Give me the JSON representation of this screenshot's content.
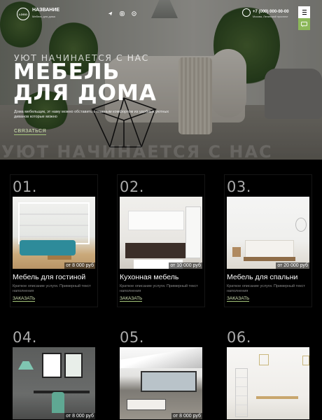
{
  "header": {
    "logo_text": "LOGO",
    "brand_name": "НАЗВАНИЕ",
    "brand_tagline": "Мебель для дома",
    "socials": [
      "telegram-icon",
      "instagram-icon",
      "whatsapp-icon"
    ],
    "phone": "+7 (000) 000-00-00",
    "address": "Москва, Ленинский проспект"
  },
  "hero": {
    "kicker": "УЮТ НАЧИНАЕТСЯ С НАС",
    "title_line1": "МЕБЕЛЬ",
    "title_line2": "ДЛЯ ДОМА",
    "description": "Дома мебельщик, эт наму можно обставить с главным комфортом из удобных уютных диванов которые можно",
    "cta": "СВЯЗАТЬСЯ",
    "ghost_text": "УЮТ НАЧИНАЕТСЯ С НАС"
  },
  "colors": {
    "accent": "#8cb85a",
    "background": "#000000"
  },
  "cards": [
    {
      "num": "01.",
      "title": "Мебель для гостиной",
      "desc": "Краткое описание услуги. Примерный текст наполнения",
      "price": "от 8 000 руб",
      "order": "ЗАКАЗАТЬ"
    },
    {
      "num": "02.",
      "title": "Кухонная мебель",
      "desc": "Краткое описание услуги. Примерный текст наполнения",
      "price": "от 10 000 руб",
      "order": "ЗАКАЗАТЬ"
    },
    {
      "num": "03.",
      "title": "Мебель для спальни",
      "desc": "Краткое описание услуги. Примерный текст наполнения",
      "price": "от 20 000 руб",
      "order": "ЗАКАЗАТЬ"
    },
    {
      "num": "04.",
      "title": "",
      "desc": "",
      "price": "от 8 000 руб",
      "order": ""
    },
    {
      "num": "05.",
      "title": "",
      "desc": "",
      "price": "от 8 000 руб",
      "order": ""
    },
    {
      "num": "06.",
      "title": "",
      "desc": "",
      "price": "",
      "order": ""
    }
  ]
}
